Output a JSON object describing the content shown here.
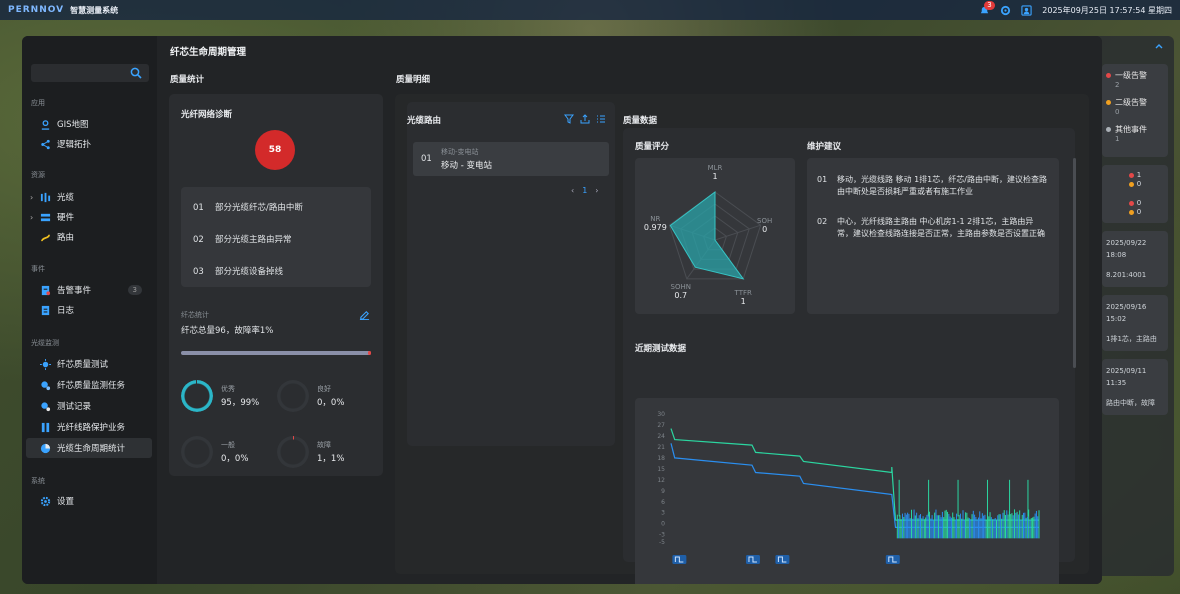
{
  "topbar": {
    "brand_logo": "PERNNOV",
    "brand_name": "智慧测量系统",
    "notif_count": "3",
    "datetime": "2025年09月25日 17:57:54 星期四"
  },
  "sidebar": {
    "search_placeholder": "",
    "sections": {
      "app": "应用",
      "resource": "资源",
      "event": "事件",
      "monitor": "光缆监测",
      "system": "系统"
    },
    "items": {
      "gis": "GIS地图",
      "topo": "逻辑拓扑",
      "cable": "光缆",
      "hardware": "硬件",
      "route": "路由",
      "alarm": "告警事件",
      "alarm_count": "3",
      "log": "日志",
      "fiber_test": "纤芯质量测试",
      "fiber_task": "纤芯质量监测任务",
      "test_record": "测试记录",
      "protect": "光纤线路保护业务",
      "lifecycle": "光缆生命周期统计",
      "settings": "设置"
    }
  },
  "page": {
    "title": "纤芯生命周期管理",
    "quality_stats": "质量统计",
    "quality_detail": "质量明细"
  },
  "diagnosis": {
    "title": "光纤网络诊断",
    "score": "58",
    "issues": [
      {
        "num": "01",
        "text": "部分光缆纤芯/路由中断"
      },
      {
        "num": "02",
        "text": "部分光缆主路由异常"
      },
      {
        "num": "03",
        "text": "部分光缆设备掉线"
      }
    ],
    "stat_label": "纤芯统计",
    "stat_text": "纤芯总量96，故障率1%",
    "bar_fraction": 0.99,
    "rings": [
      {
        "label": "优秀",
        "value": "95，99%",
        "color": "#2bb6c8",
        "fraction": 0.99
      },
      {
        "label": "良好",
        "value": "0，0%",
        "color": "#3a3d41",
        "fraction": 0
      },
      {
        "label": "一般",
        "value": "0，0%",
        "color": "#3a3d41",
        "fraction": 0
      },
      {
        "label": "故障",
        "value": "1，1%",
        "color": "#e34848",
        "fraction": 0.01
      }
    ]
  },
  "routes": {
    "title": "光缆路由",
    "items": [
      {
        "num": "01",
        "small": "移动-变电站",
        "name": "移动 - 变电站"
      }
    ],
    "pager": {
      "prev": "‹",
      "current": "1",
      "next": "›"
    }
  },
  "quality": {
    "title": "质量数据",
    "score_title": "质量评分",
    "advice_title": "维护建议",
    "radar": [
      {
        "label": "MLR",
        "value": "1"
      },
      {
        "label": "SOH",
        "value": "0"
      },
      {
        "label": "TTFR",
        "value": "1"
      },
      {
        "label": "SOHN",
        "value": "0.7"
      },
      {
        "label": "NR",
        "value": "0.979"
      }
    ],
    "advice": [
      {
        "num": "01",
        "text": "移动，光缆线路 移动 1排1芯，纤芯/路由中断，建议检查路由中断处是否损耗严重或者有施工作业"
      },
      {
        "num": "02",
        "text": "中心，光纤线路主路由 中心机房1-1 2排1芯，主路由异常，建议检查线路连接是否正常，主路由参数是否设置正确"
      }
    ],
    "recent_title": "近期测试数据"
  },
  "chart_data": {
    "type": "line",
    "title": "",
    "xlabel": "",
    "ylabel": "",
    "yticks": [
      "30",
      "27",
      "24",
      "21",
      "18",
      "15",
      "12",
      "9",
      "6",
      "3",
      "0",
      "-3",
      "-5"
    ],
    "ylim": [
      -5,
      30
    ],
    "series": [
      {
        "color": "#2bd6a0",
        "points": [
          [
            0,
            26
          ],
          [
            0.01,
            23
          ],
          [
            0.22,
            21.5
          ],
          [
            0.23,
            19.5
          ],
          [
            0.35,
            18.5
          ],
          [
            0.36,
            17
          ],
          [
            0.6,
            14
          ],
          [
            0.6,
            15.5
          ],
          [
            0.61,
            1
          ],
          [
            1,
            1
          ]
        ]
      },
      {
        "color": "#2a8ef0",
        "points": [
          [
            0,
            22
          ],
          [
            0.01,
            18
          ],
          [
            0.22,
            16
          ],
          [
            0.23,
            14
          ],
          [
            0.35,
            13
          ],
          [
            0.36,
            11
          ],
          [
            0.6,
            8
          ],
          [
            0.61,
            -1
          ],
          [
            1,
            -1
          ]
        ]
      }
    ],
    "markers": [
      "event-1",
      "event-2",
      "event-3",
      "event-4"
    ]
  },
  "alarm_panel": {
    "items": [
      {
        "label": "一级告警",
        "count": "2",
        "color": "#e34848"
      },
      {
        "label": "二级告警",
        "count": "0",
        "color": "#f0a020"
      },
      {
        "label": "其他事件",
        "count": "1",
        "color": "#aab0b6"
      }
    ],
    "mini": [
      {
        "a": "1",
        "b": "0"
      },
      {
        "a": "0",
        "b": "0"
      }
    ],
    "cards": [
      {
        "line1": "2025/09/22 18:08",
        "line2": "8.201:4001"
      },
      {
        "line1": "2025/09/16 15:02",
        "line2": "1排1芯，主路由"
      },
      {
        "line1": "2025/09/11 11:35",
        "line2": "路由中断，故障"
      }
    ]
  }
}
